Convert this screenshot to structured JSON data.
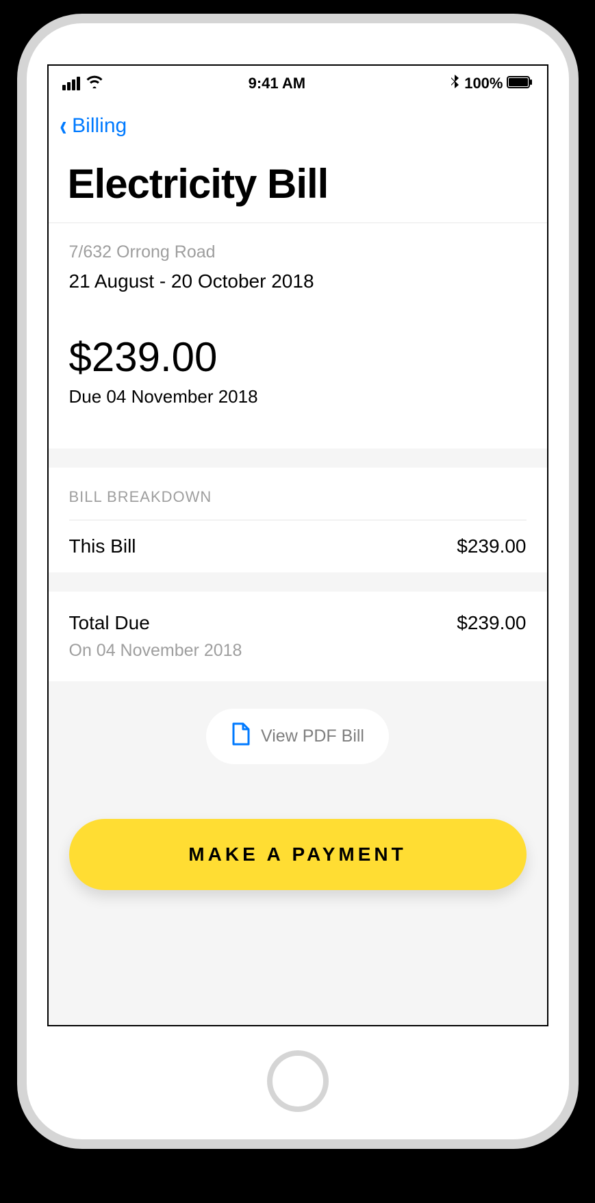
{
  "statusBar": {
    "time": "9:41 AM",
    "battery": "100%"
  },
  "nav": {
    "backLabel": "Billing"
  },
  "page": {
    "title": "Electricity Bill"
  },
  "summary": {
    "address": "7/632 Orrong Road",
    "dateRange": "21 August - 20 October 2018",
    "amount": "$239.00",
    "dueDate": "Due 04 November 2018"
  },
  "breakdown": {
    "header": "BILL BREAKDOWN",
    "items": [
      {
        "label": "This Bill",
        "value": "$239.00"
      }
    ]
  },
  "total": {
    "label": "Total Due",
    "value": "$239.00",
    "date": "On 04 November 2018"
  },
  "actions": {
    "viewPdf": "View PDF Bill",
    "makePayment": "MAKE A PAYMENT"
  }
}
